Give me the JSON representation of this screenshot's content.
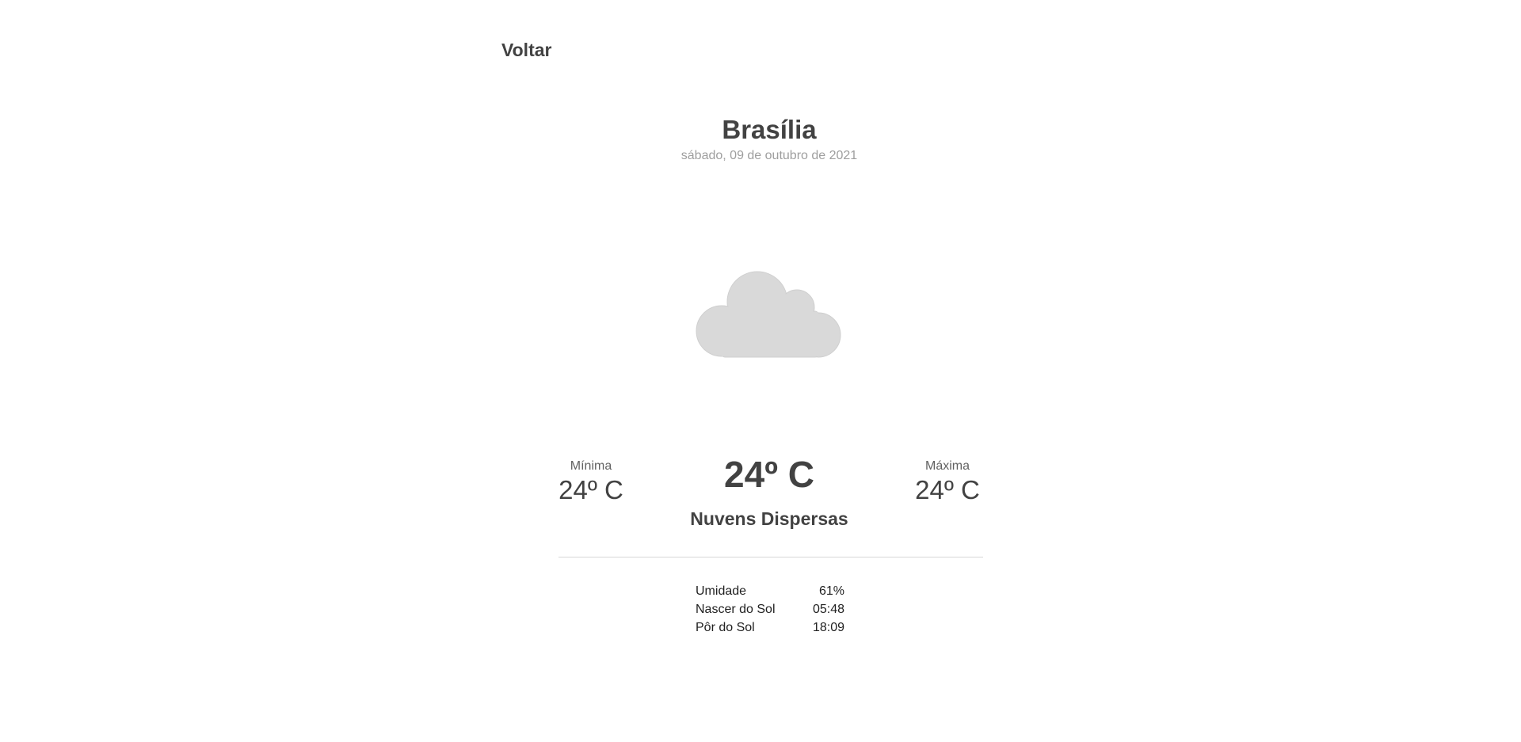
{
  "nav": {
    "back_label": "Voltar"
  },
  "location": {
    "city": "Brasília",
    "date": "sábado, 09 de outubro de 2021"
  },
  "icon": {
    "name": "cloud-icon",
    "color": "#d9d9d9"
  },
  "temperature": {
    "current": "24º C",
    "min_label": "Mínima",
    "min_value": "24º C",
    "max_label": "Máxima",
    "max_value": "24º C"
  },
  "condition": "Nuvens Dispersas",
  "details": [
    {
      "label": "Umidade",
      "value": "61%"
    },
    {
      "label": "Nascer do Sol",
      "value": "05:48"
    },
    {
      "label": "Pôr do Sol",
      "value": "18:09"
    }
  ]
}
